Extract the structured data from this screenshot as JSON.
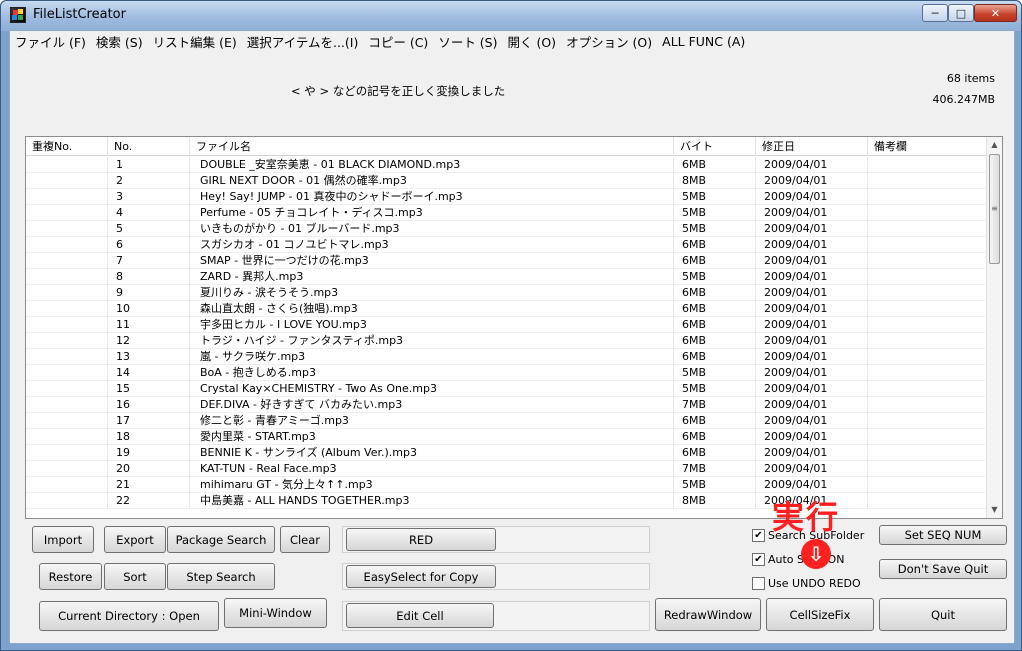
{
  "window": {
    "title": "FileListCreator",
    "min_glyph": "─",
    "max_glyph": "□",
    "close_glyph": "✕"
  },
  "menu": [
    "ファイル (F)",
    "検索 (S)",
    "リスト編集 (E)",
    "選択アイテムを...(I)",
    "コピー (C)",
    "ソート (S)",
    "開く (O)",
    "オプション (O)",
    "ALL FUNC (A)"
  ],
  "status": {
    "message": "< や > などの記号を正しく変換しました",
    "items_count": "68 items",
    "total_size": "406.247MB"
  },
  "grid": {
    "columns": [
      "重複No.",
      "No.",
      "ファイル名",
      "バイト",
      "修正日",
      "備考欄"
    ],
    "rows": [
      [
        "",
        "1",
        "DOUBLE _安室奈美恵 - 01 BLACK DIAMOND.mp3",
        "6MB",
        "2009/04/01",
        ""
      ],
      [
        "",
        "2",
        "GIRL NEXT DOOR - 01 偶然の確率.mp3",
        "8MB",
        "2009/04/01",
        ""
      ],
      [
        "",
        "3",
        "Hey! Say! JUMP - 01 真夜中のシャドーボーイ.mp3",
        "5MB",
        "2009/04/01",
        ""
      ],
      [
        "",
        "4",
        "Perfume - 05 チョコレイト・ディスコ.mp3",
        "5MB",
        "2009/04/01",
        ""
      ],
      [
        "",
        "5",
        "いきものがかり - 01 ブルーバード.mp3",
        "5MB",
        "2009/04/01",
        ""
      ],
      [
        "",
        "6",
        "スガシカオ - 01 コノユビトマレ.mp3",
        "6MB",
        "2009/04/01",
        ""
      ],
      [
        "",
        "7",
        "SMAP - 世界に一つだけの花.mp3",
        "6MB",
        "2009/04/01",
        ""
      ],
      [
        "",
        "8",
        "ZARD - 異邦人.mp3",
        "5MB",
        "2009/04/01",
        ""
      ],
      [
        "",
        "9",
        "夏川りみ - 涙そうそう.mp3",
        "6MB",
        "2009/04/01",
        ""
      ],
      [
        "",
        "10",
        "森山直太朗 - さくら(独唱).mp3",
        "6MB",
        "2009/04/01",
        ""
      ],
      [
        "",
        "11",
        "宇多田ヒカル - I LOVE YOU.mp3",
        "6MB",
        "2009/04/01",
        ""
      ],
      [
        "",
        "12",
        "トラジ・ハイジ - ファンタスティポ.mp3",
        "6MB",
        "2009/04/01",
        ""
      ],
      [
        "",
        "13",
        "嵐 - サクラ咲ケ.mp3",
        "6MB",
        "2009/04/01",
        ""
      ],
      [
        "",
        "14",
        "BoA - 抱きしめる.mp3",
        "5MB",
        "2009/04/01",
        ""
      ],
      [
        "",
        "15",
        "Crystal Kay×CHEMISTRY - Two As One.mp3",
        "5MB",
        "2009/04/01",
        ""
      ],
      [
        "",
        "16",
        "DEF.DIVA - 好きすぎて バカみたい.mp3",
        "7MB",
        "2009/04/01",
        ""
      ],
      [
        "",
        "17",
        "修二と彰 - 青春アミーゴ.mp3",
        "6MB",
        "2009/04/01",
        ""
      ],
      [
        "",
        "18",
        "愛内里菜 - START.mp3",
        "6MB",
        "2009/04/01",
        ""
      ],
      [
        "",
        "19",
        "BENNIE K - サンライズ (Album Ver.).mp3",
        "6MB",
        "2009/04/01",
        ""
      ],
      [
        "",
        "20",
        "KAT-TUN - Real Face.mp3",
        "7MB",
        "2009/04/01",
        ""
      ],
      [
        "",
        "21",
        "mihimaru GT - 気分上々↑↑.mp3",
        "5MB",
        "2009/04/01",
        ""
      ],
      [
        "",
        "22",
        "中島美嘉 - ALL HANDS TOGETHER.mp3",
        "8MB",
        "2009/04/01",
        ""
      ]
    ]
  },
  "buttons": {
    "import": "Import",
    "export": "Export",
    "package_search": "Package Search",
    "clear": "Clear",
    "red": "RED",
    "restore": "Restore",
    "sort": "Sort",
    "step_search": "Step Search",
    "easy_select": "EasySelect for Copy",
    "current_dir": "Current Directory : Open",
    "mini_window": "Mini-Window",
    "edit_cell": "Edit Cell",
    "redraw_window": "RedrawWindow",
    "cell_size_fix": "CellSizeFix",
    "quit": "Quit",
    "set_seq_num": "Set SEQ NUM",
    "dont_save_quit": "Don't Save Quit"
  },
  "checkboxes": [
    {
      "label": "Search SubFolder",
      "checked": true
    },
    {
      "label": "Auto Save ON",
      "checked": true
    },
    {
      "label": "Use UNDO REDO",
      "checked": false
    }
  ],
  "overlay": {
    "text": "実行",
    "arrow": "⇩"
  },
  "colors": {
    "overlay": "#ff1f1f",
    "title_gradient_top": "#c7dbf1",
    "client_bg": "#f0f0f0"
  }
}
